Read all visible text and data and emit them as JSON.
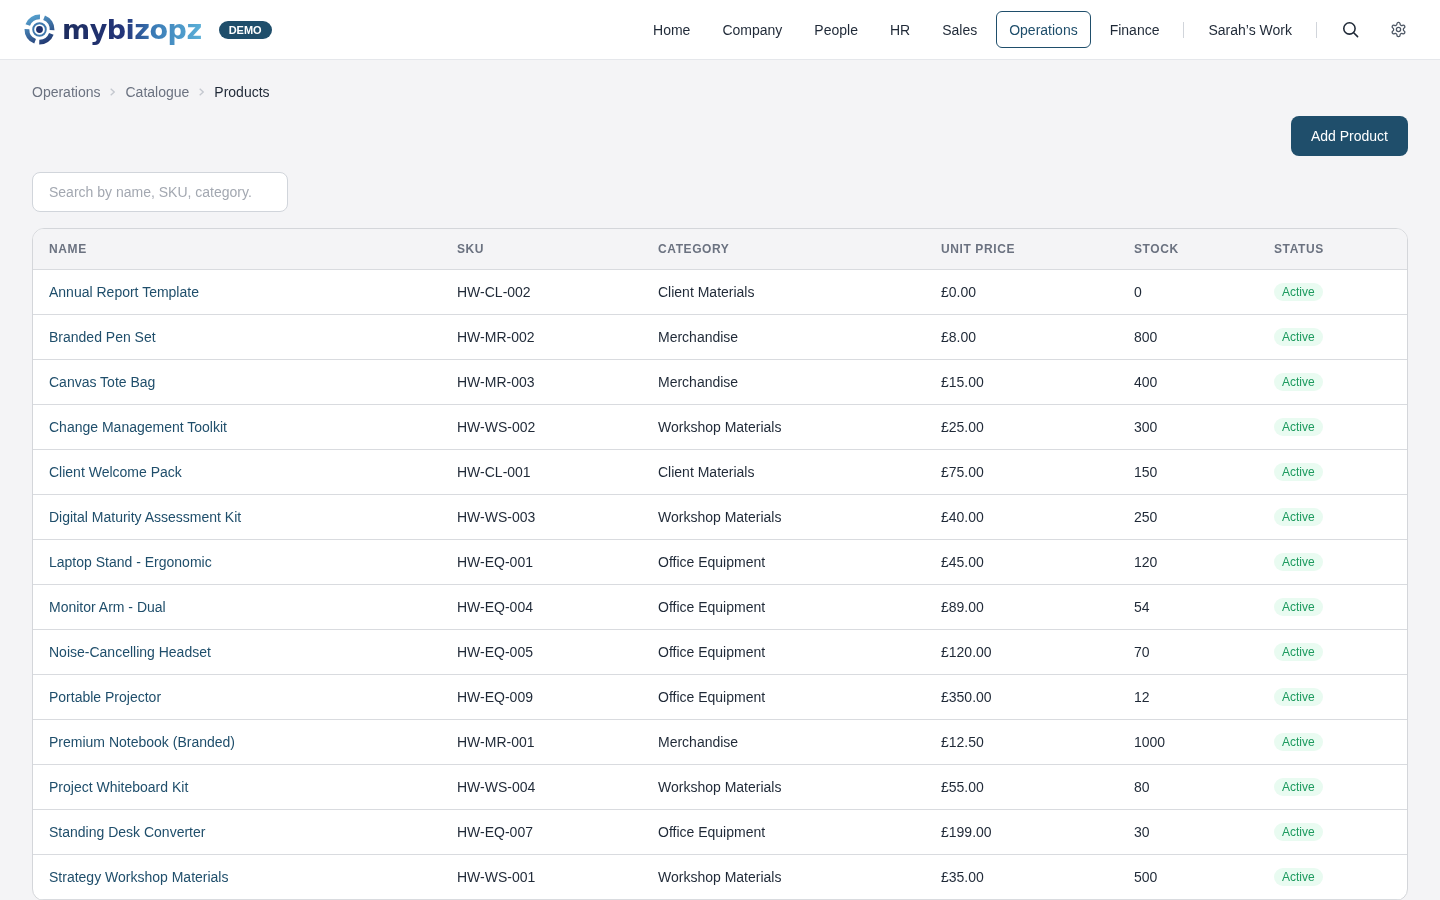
{
  "header": {
    "logo": {
      "text": "mybizopz"
    },
    "badge": "DEMO"
  },
  "nav": {
    "items": [
      {
        "label": "Home",
        "selected": false
      },
      {
        "label": "Company",
        "selected": false
      },
      {
        "label": "People",
        "selected": false
      },
      {
        "label": "HR",
        "selected": false
      },
      {
        "label": "Sales",
        "selected": false
      },
      {
        "label": "Operations",
        "selected": true
      },
      {
        "label": "Finance",
        "selected": false
      }
    ],
    "personal": [
      {
        "label": "Sarah’s Work",
        "selected": false
      }
    ]
  },
  "breadcrumb": [
    "Operations",
    "Catalogue",
    "Products"
  ],
  "actions": {
    "add_button": "Add Product"
  },
  "search": {
    "placeholder": "Search by name, SKU, category."
  },
  "table": {
    "columns": [
      "NAME",
      "SKU",
      "CATEGORY",
      "UNIT PRICE",
      "STOCK",
      "STATUS"
    ],
    "rows": [
      {
        "name": "Annual Report Template",
        "sku": "HW-CL-002",
        "category": "Client Materials",
        "unit_price": "£0.00",
        "stock": "0",
        "status": "Active"
      },
      {
        "name": "Branded Pen Set",
        "sku": "HW-MR-002",
        "category": "Merchandise",
        "unit_price": "£8.00",
        "stock": "800",
        "status": "Active"
      },
      {
        "name": "Canvas Tote Bag",
        "sku": "HW-MR-003",
        "category": "Merchandise",
        "unit_price": "£15.00",
        "stock": "400",
        "status": "Active"
      },
      {
        "name": "Change Management Toolkit",
        "sku": "HW-WS-002",
        "category": "Workshop Materials",
        "unit_price": "£25.00",
        "stock": "300",
        "status": "Active"
      },
      {
        "name": "Client Welcome Pack",
        "sku": "HW-CL-001",
        "category": "Client Materials",
        "unit_price": "£75.00",
        "stock": "150",
        "status": "Active"
      },
      {
        "name": "Digital Maturity Assessment Kit",
        "sku": "HW-WS-003",
        "category": "Workshop Materials",
        "unit_price": "£40.00",
        "stock": "250",
        "status": "Active"
      },
      {
        "name": "Laptop Stand - Ergonomic",
        "sku": "HW-EQ-001",
        "category": "Office Equipment",
        "unit_price": "£45.00",
        "stock": "120",
        "status": "Active"
      },
      {
        "name": "Monitor Arm - Dual",
        "sku": "HW-EQ-004",
        "category": "Office Equipment",
        "unit_price": "£89.00",
        "stock": "54",
        "status": "Active"
      },
      {
        "name": "Noise-Cancelling Headset",
        "sku": "HW-EQ-005",
        "category": "Office Equipment",
        "unit_price": "£120.00",
        "stock": "70",
        "status": "Active"
      },
      {
        "name": "Portable Projector",
        "sku": "HW-EQ-009",
        "category": "Office Equipment",
        "unit_price": "£350.00",
        "stock": "12",
        "status": "Active"
      },
      {
        "name": "Premium Notebook (Branded)",
        "sku": "HW-MR-001",
        "category": "Merchandise",
        "unit_price": "£12.50",
        "stock": "1000",
        "status": "Active"
      },
      {
        "name": "Project Whiteboard Kit",
        "sku": "HW-WS-004",
        "category": "Workshop Materials",
        "unit_price": "£55.00",
        "stock": "80",
        "status": "Active"
      },
      {
        "name": "Standing Desk Converter",
        "sku": "HW-EQ-007",
        "category": "Office Equipment",
        "unit_price": "£199.00",
        "stock": "30",
        "status": "Active"
      },
      {
        "name": "Strategy Workshop Materials",
        "sku": "HW-WS-001",
        "category": "Workshop Materials",
        "unit_price": "£35.00",
        "stock": "500",
        "status": "Active"
      }
    ]
  }
}
